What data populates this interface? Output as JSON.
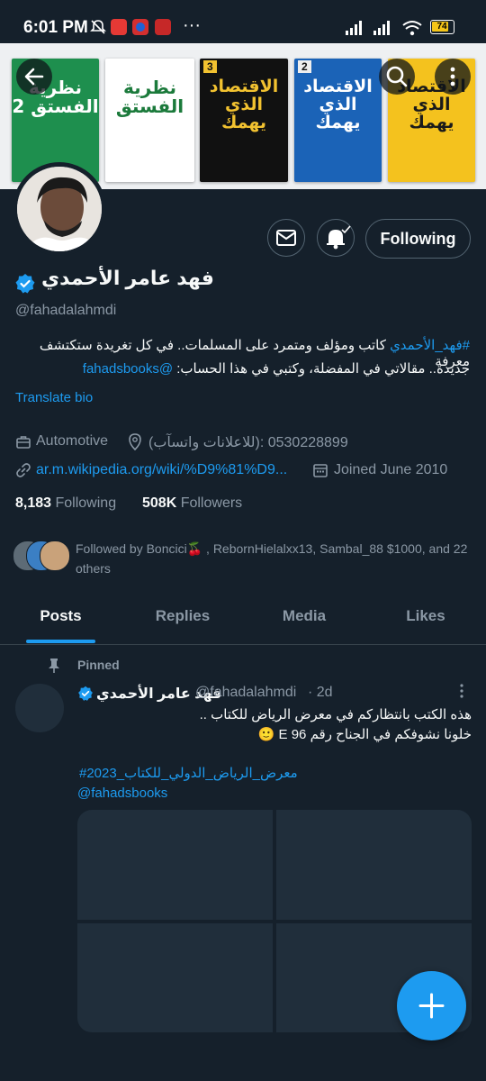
{
  "status_bar": {
    "time": "6:01 PM",
    "battery": "74"
  },
  "banner": {
    "books": [
      {
        "title": "نظرية الفستق 2",
        "bg": "#1e8f4e",
        "fg": "#ffffff"
      },
      {
        "title": "نظرية الفستق",
        "bg": "#ffffff",
        "fg": "#1b7a3b"
      },
      {
        "title": "الاقتصاد الذي يهمك",
        "bg": "#111111",
        "fg": "#f2c230",
        "badge": "3"
      },
      {
        "title": "الاقتصاد الذي يهمك",
        "bg": "#1b63b7",
        "fg": "#ffffff",
        "badge": "2"
      },
      {
        "title": "الاقتصاد الذي يهمك",
        "bg": "#f4c21e",
        "fg": "#1a1a1a"
      }
    ]
  },
  "profile": {
    "name": "فهد عامر الأحمدي",
    "handle": "@fahadalahmdi",
    "bio_line1_hashtag": "#فهد_الأحمدي",
    "bio_line1_text": " كاتب ومؤلف ومتمرد على المسلمات.. في كل تغريدة ستكتشف معرفة",
    "bio_line2_text": "جديدة.. مقالاتي في المفضلة، وكتبي في هذا الحساب: ",
    "bio_line2_link": "@fahadsbooks",
    "translate": "Translate bio",
    "category": "Automotive",
    "location": "(للاعلانات واتسآب): 0530228899",
    "website": "ar.m.wikipedia.org/wiki/%D9%81%D9...",
    "joined": "Joined June 2010",
    "following_count": "8,183",
    "following_label": "Following",
    "followers_count": "508K",
    "followers_label": "Followers",
    "followed_by": "Followed by Boncici🍒 , RebornHielalxx13, Sambal_88 $1000, and 22 others",
    "following_button": "Following"
  },
  "tabs": [
    {
      "label": "Posts",
      "active": true
    },
    {
      "label": "Replies",
      "active": false
    },
    {
      "label": "Media",
      "active": false
    },
    {
      "label": "Likes",
      "active": false
    }
  ],
  "post": {
    "pinned_label": "Pinned",
    "author_name": "فهد عامر الأحمدي",
    "author_handle": "@fahadalahmdi",
    "time": "· 2d",
    "line1": "هذه الكتب بانتظاركم في معرض الرياض للكتاب ..",
    "line2": "خلونا نشوفكم في الجناح رقم E 96 🙂",
    "hashtag": "#معرض_الرياض_الدولي_للكتاب_2023",
    "mention": "@fahadsbooks"
  },
  "colors": {
    "accent": "#1d9bf0",
    "background": "#15202b",
    "muted": "#8b98a5",
    "border": "#38444d"
  },
  "icons": [
    "back-arrow-icon",
    "search-icon",
    "more-vertical-icon",
    "mail-icon",
    "bell-icon",
    "verified-badge-icon",
    "briefcase-icon",
    "location-pin-icon",
    "link-icon",
    "calendar-icon",
    "pin-icon",
    "compose-plus-icon"
  ]
}
